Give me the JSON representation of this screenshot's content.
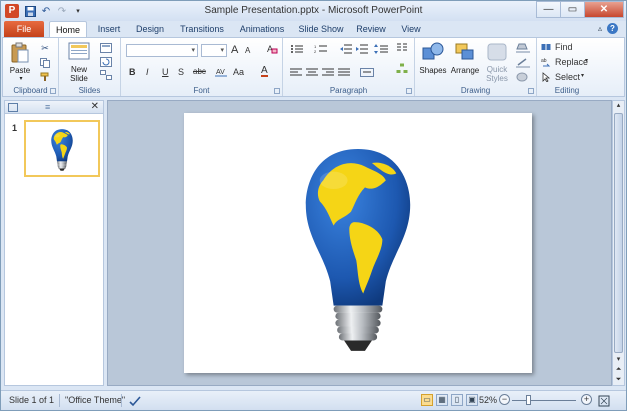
{
  "window": {
    "title": "Sample Presentation.pptx - Microsoft PowerPoint",
    "app_icon_letter": "P"
  },
  "tabs": {
    "file": "File",
    "items": [
      "Home",
      "Insert",
      "Design",
      "Transitions",
      "Animations",
      "Slide Show",
      "Review",
      "View"
    ]
  },
  "ribbon": {
    "clipboard": {
      "label": "Clipboard",
      "paste": "Paste"
    },
    "slides": {
      "label": "Slides",
      "new_slide_line1": "New",
      "new_slide_line2": "Slide"
    },
    "font": {
      "label": "Font",
      "bold": "B",
      "italic": "I",
      "underline": "U",
      "strike": "S",
      "abc": "abc",
      "grow": "A",
      "shrink": "A",
      "case": "Aa",
      "color": "A"
    },
    "paragraph": {
      "label": "Paragraph"
    },
    "drawing": {
      "label": "Drawing",
      "shapes": "Shapes",
      "arrange": "Arrange",
      "quick_styles_line1": "Quick",
      "quick_styles_line2": "Styles"
    },
    "editing": {
      "label": "Editing",
      "find": "Find",
      "replace": "Replace",
      "select": "Select"
    }
  },
  "slides_pane": {
    "slide_number": "1"
  },
  "status_bar": {
    "slide_info": "Slide 1 of 1",
    "theme": "\"Office Theme\"",
    "zoom": "52%",
    "zoom_minus": "−",
    "zoom_plus": "+"
  },
  "colors": {
    "file_tab": "#c4411a",
    "globe_blue": "#1f5eb8",
    "continent_yellow": "#f5d516"
  }
}
